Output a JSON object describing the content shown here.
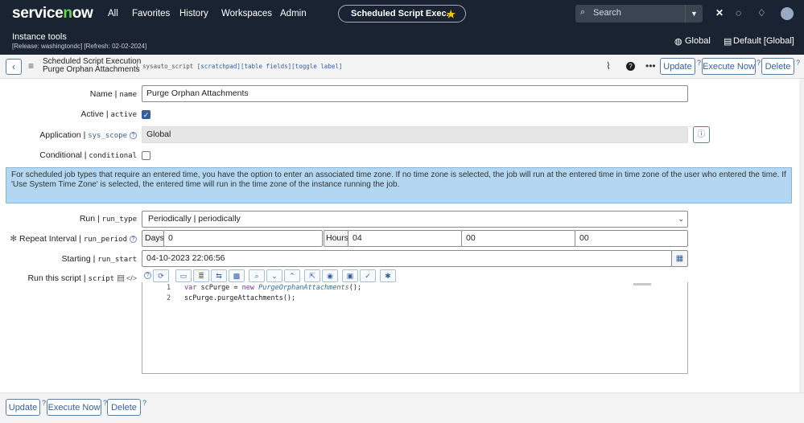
{
  "topnav": {
    "logo": "servicenow",
    "links": [
      "All",
      "Favorites",
      "History",
      "Workspaces",
      "Admin"
    ],
    "pill_title": "Scheduled Script Exec...",
    "search_placeholder": "Search"
  },
  "instance": {
    "title": "Instance tools",
    "release": "[Release: washingtondc] [Refresh: 02-02-2024]",
    "scope": "Global",
    "update_set": "Default [Global]"
  },
  "record": {
    "table_label": "Scheduled Script Execution",
    "record_name": "Purge Orphan Attachments",
    "table_name": "| sysauto_script",
    "links": [
      "[scratchpad]",
      "[table fields]",
      "[toggle label]"
    ],
    "buttons": {
      "update": "Update",
      "execute": "Execute Now",
      "delete": "Delete"
    }
  },
  "form": {
    "name": {
      "label": "Name | ",
      "field": "name",
      "value": "Purge Orphan Attachments"
    },
    "active": {
      "label": "Active | ",
      "field": "active",
      "checked": true
    },
    "application": {
      "label": "Application | ",
      "field": "sys_scope",
      "value": "Global"
    },
    "conditional": {
      "label": "Conditional | ",
      "field": "conditional",
      "checked": false
    },
    "info": "For scheduled job types that require an entered time, you have the option to enter an associated time zone. If no time zone is selected, the job will run at the entered time in time zone of the user who entered the time. If 'Use System Time Zone' is selected, the entered time will run in the time zone of the instance running the job.",
    "run": {
      "label": "Run | ",
      "field": "run_type",
      "value": "Periodically | periodically"
    },
    "repeat": {
      "label": "Repeat Interval | ",
      "field": "run_period",
      "days_label": "Days",
      "days": "0",
      "hours_label": "Hours",
      "hours": "04",
      "minutes": "00",
      "seconds": "00"
    },
    "starting": {
      "label": "Starting | ",
      "field": "run_start",
      "value": "04-10-2023 22:06:56"
    },
    "script": {
      "label": "Run this script | ",
      "field": "script",
      "lines": [
        {
          "num": "1",
          "kw": "var",
          "a": " scPurge = ",
          "kw2": "new",
          "cls": " PurgeOrphanAttachments",
          "b": "();"
        },
        {
          "num": "2",
          "text": "scPurge.purgeAttachments();"
        }
      ]
    }
  },
  "footer": {
    "update": "Update",
    "execute": "Execute Now",
    "delete": "Delete"
  }
}
